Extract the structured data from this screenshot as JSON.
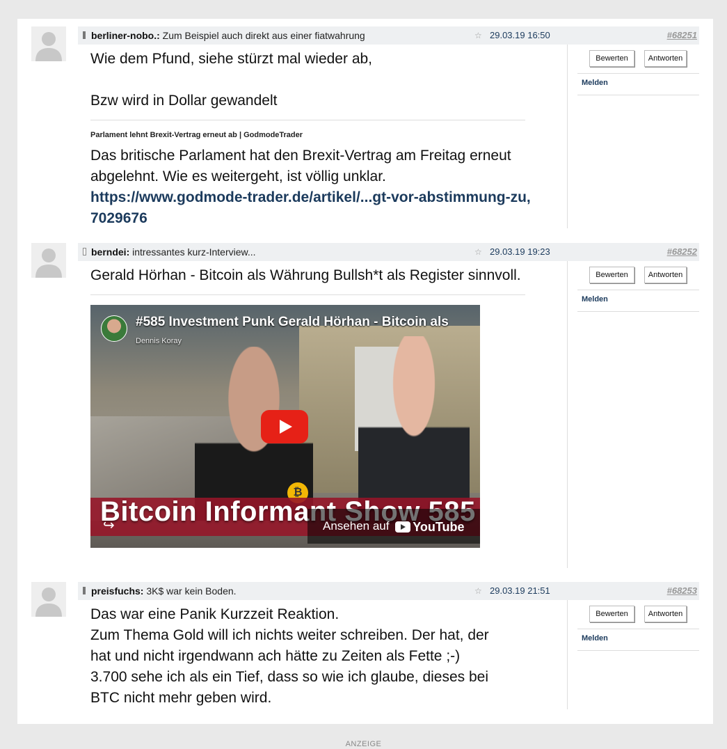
{
  "posts": [
    {
      "author": "berliner-nobo.:",
      "subject": "Zum Beispiel auch direkt aus einer fiatwahrung",
      "date": "29.03.19 16:50",
      "number": "#68251",
      "body_lines": [
        "Wie dem Pfund,  siehe stürzt mal wieder ab,",
        "Bzw wird in Dollar gewandelt"
      ],
      "link_preview": {
        "title": "Parlament lehnt Brexit-Vertrag erneut ab | GodmodeTrader",
        "text": "Das britische Parlament hat den Brexit-Vertrag am Freitag erneut abgelehnt. Wie es weitergeht, ist völlig unklar.",
        "url": "https://www.godmode-trader.de/artikel/...gt-vor-abstimmung-zu,7029676"
      }
    },
    {
      "author": "berndei:",
      "subject": "intressantes kurz-Interview...",
      "date": "29.03.19 19:23",
      "number": "#68252",
      "body_lines": [
        "Gerald Hörhan - Bitcoin als Währung Bullsh*t als Register sinnvoll."
      ],
      "video": {
        "title": "#585 Investment Punk Gerald Hörhan - Bitcoin als",
        "channel": "Dennis Koray",
        "banner": "Bitcoin Informant Show 585",
        "watch_label": "Ansehen auf",
        "youtube_label": "YouTube"
      }
    },
    {
      "author": "preisfuchs:",
      "subject": "3K$ war kein Boden.",
      "date": "29.03.19 21:51",
      "number": "#68253",
      "body_lines": [
        "Das war eine Panik Kurzzeit Reaktion.",
        "Zum Thema Gold will ich nichts weiter schreiben. Der hat, der hat und nicht irgendwann ach hätte zu Zeiten als Fette ;-)",
        "3.700 sehe ich als ein Tief, dass so wie ich glaube, dieses bei BTC nicht mehr geben wird."
      ]
    }
  ],
  "actions": {
    "rate": "Bewerten",
    "reply": "Antworten",
    "report": "Melden"
  },
  "footer": {
    "ad_label": "ANZEIGE"
  }
}
